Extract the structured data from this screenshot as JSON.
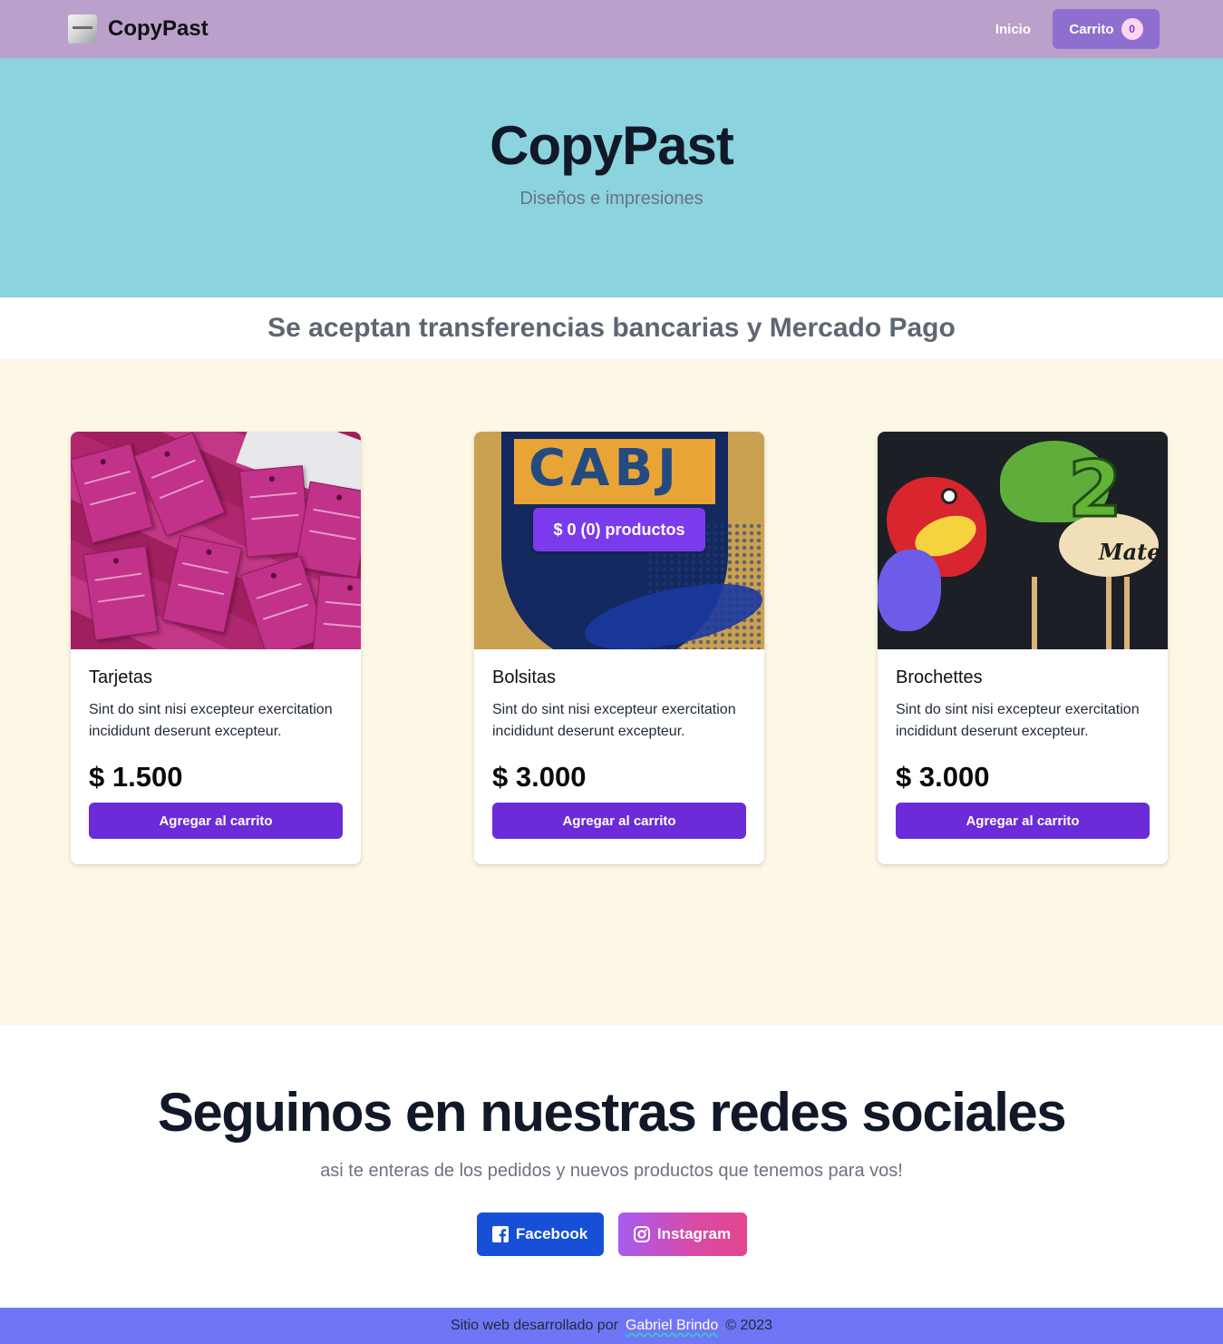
{
  "navbar": {
    "brand_name": "CopyPast",
    "inicio_label": "Inicio",
    "cart_label": "Carrito",
    "cart_count": "0"
  },
  "hero": {
    "title": "CopyPast",
    "subtitle": "Diseños e impresiones"
  },
  "banner": {
    "text": "Se aceptan transferencias bancarias y Mercado Pago"
  },
  "cart_summary": "$ 0 (0) productos",
  "products": [
    {
      "title": "Tarjetas",
      "description": "Sint do sint nisi excepteur exercitation incididunt deserunt excepteur.",
      "price": "$ 1.500",
      "button": "Agregar al carrito"
    },
    {
      "title": "Bolsitas",
      "description": "Sint do sint nisi excepteur exercitation incididunt deserunt excepteur.",
      "price": "$ 3.000",
      "button": "Agregar al carrito"
    },
    {
      "title": "Brochettes",
      "description": "Sint do sint nisi excepteur exercitation incididunt deserunt excepteur.",
      "price": "$ 3.000",
      "button": "Agregar al carrito"
    }
  ],
  "product_images": {
    "cabj_text": "CABJ",
    "cabj_stars": "★★★★★★★",
    "dino_number": "2",
    "dino_name": "Mateo"
  },
  "social": {
    "title": "Seguinos en nuestras redes sociales",
    "subtitle": "asi te enteras de los pedidos y nuevos productos que tenemos para vos!",
    "facebook_label": "Facebook",
    "instagram_label": "Instagram",
    "facebook_icon": "facebook-icon",
    "instagram_icon": "instagram-icon"
  },
  "footer": {
    "prefix": "Sitio web desarrollado por",
    "author": "Gabriel Brindo",
    "suffix": "© 2023"
  },
  "colors": {
    "navbar": "#bba0cb",
    "hero": "#8bd3de",
    "products_bg": "#fdf7e5",
    "button": "#6b2bd9",
    "footer": "#6f76f5"
  }
}
